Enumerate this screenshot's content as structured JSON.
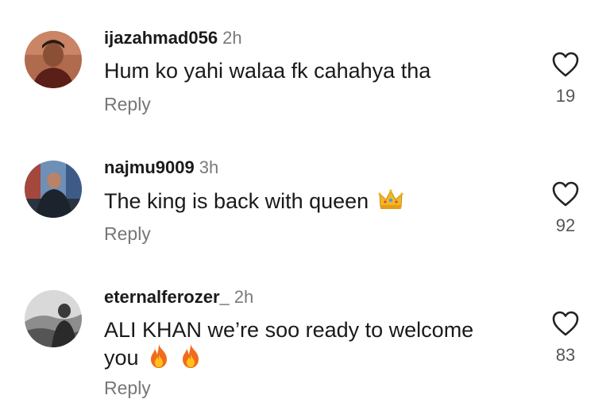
{
  "comments": [
    {
      "username": "ijazahmad056",
      "time": "2h",
      "text": "Hum ko yahi walaa fk cahahya tha",
      "reply_label": "Reply",
      "likes": "19",
      "avatar_icon": "profile-photo",
      "emojis": []
    },
    {
      "username": "najmu9009",
      "time": "3h",
      "text": "The king is back with queen",
      "reply_label": "Reply",
      "likes": "92",
      "avatar_icon": "profile-photo",
      "emojis": [
        "crown-emoji"
      ]
    },
    {
      "username": "eternalferozer_",
      "time": "2h",
      "text_line1": "ALI KHAN we’re soo ready to welcome",
      "text_line2": "you",
      "reply_label": "Reply",
      "likes": "83",
      "avatar_icon": "profile-photo",
      "emojis": [
        "fire-emoji",
        "fire-emoji"
      ]
    }
  ],
  "colors": {
    "username": "#1a1a1a",
    "meta": "#7a7a7a",
    "reply": "#777777",
    "heart_stroke": "#222222"
  }
}
